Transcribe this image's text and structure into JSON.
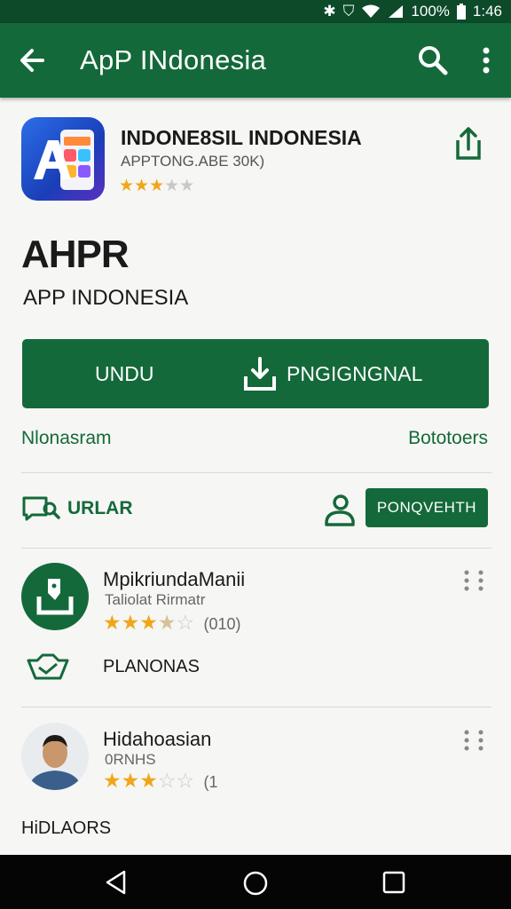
{
  "status_bar": {
    "battery": "100%",
    "time": "1:46"
  },
  "app_bar": {
    "title": "ApP INdonesia"
  },
  "app": {
    "name": "INDONE8SIL INDONESIA",
    "subtitle": "APPTONG.ABE 30K)",
    "rating_stars": 2.5
  },
  "brand": {
    "logo_text": "AHPR",
    "name": "APP INDONESIA"
  },
  "install_button": {
    "left_label": "UNDU",
    "right_label": "PNGIGNGNAL"
  },
  "meta": {
    "left": "Nlonasram",
    "right": "Bototoers"
  },
  "actions": {
    "urlar_label": "URLAR",
    "small_button_label": "PONQVEHTH"
  },
  "reviews": [
    {
      "name": "MpikriundaManii",
      "subtitle": "Taliolat Rirmatr",
      "rating": 3.5,
      "count": "(010)",
      "extra_label": "PLANONAS"
    },
    {
      "name": "Hidahoasian",
      "subtitle": "0RNHS",
      "rating": 2.5,
      "count": "(1"
    }
  ],
  "footer": {
    "label": "HiDLAORS"
  },
  "colors": {
    "primary": "#14693a",
    "primary_dark": "#0d4a2a",
    "star": "#f0a61a"
  }
}
